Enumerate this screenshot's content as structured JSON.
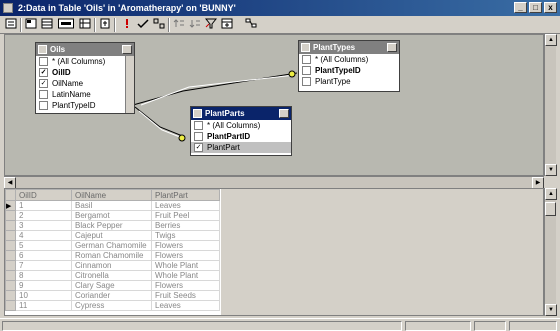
{
  "window": {
    "title": "2:Data in Table 'Oils' in 'Aromatherapy' on 'BUNNY'",
    "minimize_label": "_",
    "maximize_label": "□",
    "close_label": "x"
  },
  "toolbar": {
    "icons": [
      "properties-icon",
      "diagram-pane-icon",
      "grid-pane-icon",
      "sql-pane-icon",
      "results-pane-icon",
      "change-type-icon",
      "run-icon",
      "verify-sql-icon",
      "group-by-icon",
      "sort-asc-icon",
      "sort-desc-icon",
      "remove-filter-icon",
      "add-table-icon"
    ]
  },
  "diagram": {
    "tables": [
      {
        "name": "Oils",
        "columns": [
          {
            "label": "* (All Columns)",
            "checked": false,
            "bold": false
          },
          {
            "label": "OilID",
            "checked": true,
            "bold": true
          },
          {
            "label": "OilName",
            "checked": true,
            "bold": false
          },
          {
            "label": "LatinName",
            "checked": false,
            "bold": false
          },
          {
            "label": "PlantTypeID",
            "checked": false,
            "bold": false
          }
        ]
      },
      {
        "name": "PlantTypes",
        "columns": [
          {
            "label": "* (All Columns)",
            "checked": false,
            "bold": false
          },
          {
            "label": "PlantTypeID",
            "checked": false,
            "bold": true
          },
          {
            "label": "PlantType",
            "checked": false,
            "bold": false
          }
        ]
      },
      {
        "name": "PlantParts",
        "columns": [
          {
            "label": "* (All Columns)",
            "checked": false,
            "bold": false
          },
          {
            "label": "PlantPartID",
            "checked": false,
            "bold": true
          },
          {
            "label": "PlantPart",
            "checked": true,
            "bold": false
          }
        ]
      }
    ]
  },
  "grid": {
    "headers": [
      "OilID",
      "OilName",
      "PlantPart"
    ],
    "rows": [
      [
        "1",
        "Basil",
        "Leaves"
      ],
      [
        "2",
        "Bergamot",
        "Fruit Peel"
      ],
      [
        "3",
        "Black Pepper",
        "Berries"
      ],
      [
        "4",
        "Cajeput",
        "Twigs"
      ],
      [
        "5",
        "German Chamomile",
        "Flowers"
      ],
      [
        "6",
        "Roman Chamomile",
        "Flowers"
      ],
      [
        "7",
        "Cinnamon",
        "Whole Plant"
      ],
      [
        "8",
        "Citronella",
        "Whole Plant"
      ],
      [
        "9",
        "Clary Sage",
        "Flowers"
      ],
      [
        "10",
        "Coriander",
        "Fruit Seeds"
      ],
      [
        "11",
        "Cypress",
        "Leaves"
      ]
    ],
    "current_row_marker": "▶"
  }
}
